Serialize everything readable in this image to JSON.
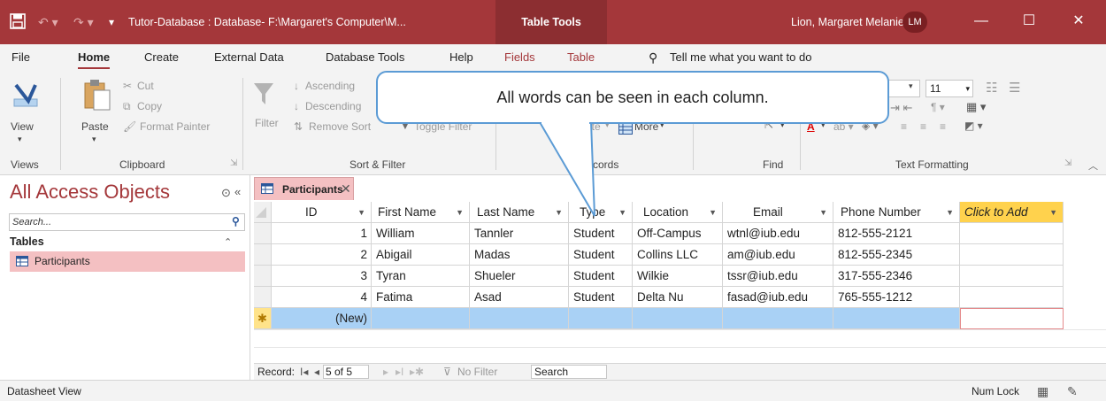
{
  "titlebar": {
    "save_icon": "save-icon",
    "undo_icon": "undo-icon",
    "redo_icon": "redo-icon",
    "title": "Tutor-Database : Database- F:\\Margaret's Computer\\M...",
    "context_tab": "Table Tools",
    "user_name": "Lion, Margaret Melanie",
    "user_initials": "LM",
    "minimize": "—",
    "maximize": "☐",
    "close": "✕"
  },
  "menu": {
    "file": "File",
    "home": "Home",
    "create": "Create",
    "external_data": "External Data",
    "database_tools": "Database Tools",
    "help": "Help",
    "fields": "Fields",
    "table": "Table",
    "tell_me": "Tell me what you want to do"
  },
  "ribbon": {
    "views": {
      "view": "View",
      "group": "Views"
    },
    "clipboard": {
      "paste": "Paste",
      "cut": "Cut",
      "copy": "Copy",
      "format_painter": "Format Painter",
      "group": "Clipboard"
    },
    "sort_filter": {
      "filter": "Filter",
      "ascending": "Ascending",
      "descending": "Descending",
      "remove_sort": "Remove Sort",
      "toggle_filter": "Toggle Filter",
      "group": "Sort & Filter"
    },
    "records": {
      "delete_partial": "ete",
      "more": "More",
      "group_partial": "cords"
    },
    "find": {
      "group": "Find"
    },
    "text_formatting": {
      "font_size": "11",
      "group": "Text Formatting"
    }
  },
  "callout": {
    "text": "All words can be seen in each column."
  },
  "nav": {
    "title": "All Access Objects",
    "search_placeholder": "Search...",
    "section": "Tables",
    "items": [
      {
        "label": "Participants"
      }
    ]
  },
  "doc_tab": {
    "label": "Participants"
  },
  "table": {
    "columns": [
      "ID",
      "First Name",
      "Last Name",
      "Type",
      "Location",
      "Email",
      "Phone Number",
      "Click to Add"
    ],
    "rows": [
      [
        "1",
        "William",
        "Tannler",
        "Student",
        "Off-Campus",
        "wtnl@iub.edu",
        "812-555-2121"
      ],
      [
        "2",
        "Abigail",
        "Madas",
        "Student",
        "Collins LLC",
        "am@iub.edu",
        "812-555-2345"
      ],
      [
        "3",
        "Tyran",
        "Shueler",
        "Student",
        "Wilkie",
        "tssr@iub.edu",
        "317-555-2346"
      ],
      [
        "4",
        "Fatima",
        "Asad",
        "Student",
        "Delta Nu",
        "fasad@iub.edu",
        "765-555-1212"
      ]
    ],
    "new_row_label": "(New)"
  },
  "record_nav": {
    "label": "Record:",
    "first": "I◂",
    "prev": "◂",
    "position": "5 of 5",
    "next": "▸",
    "last": "▸I",
    "new": "▸✱",
    "no_filter": "No Filter",
    "search": "Search"
  },
  "status": {
    "view": "Datasheet View",
    "num_lock": "Num Lock"
  },
  "colors": {
    "accent": "#a4373a",
    "selection_pink": "#f4c0c2",
    "new_row_blue": "#a9d1f5",
    "add_column_yellow": "#ffd24d",
    "callout_border": "#5b9bd5"
  }
}
